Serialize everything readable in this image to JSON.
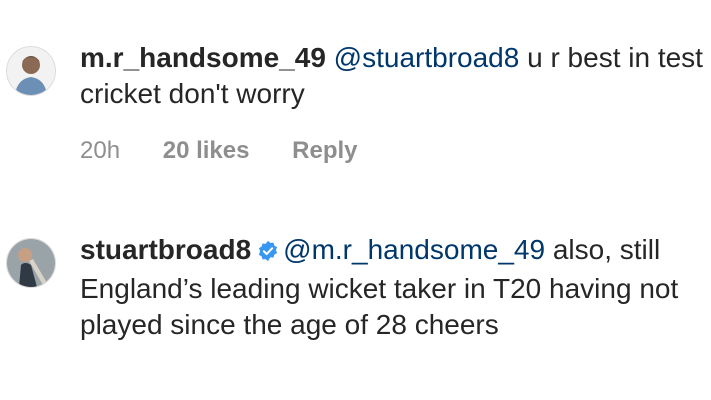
{
  "comments": [
    {
      "username": "m.r_handsome_49",
      "verified": false,
      "mention": "@stuartbroad8",
      "text": " u r best in test cricket don't worry",
      "time": "20h",
      "likes": "20 likes",
      "reply": "Reply"
    },
    {
      "username": "stuartbroad8",
      "verified": true,
      "mention": "@m.r_handsome_49",
      "text": " also, still England’s leading wicket taker in T20 having not played since the age of 28 cheers"
    }
  ],
  "colors": {
    "mention": "#00376b",
    "meta": "#8e8e8e",
    "verified": "#3897f0"
  },
  "icons": [
    "avatar-icon",
    "verified-badge-icon"
  ]
}
